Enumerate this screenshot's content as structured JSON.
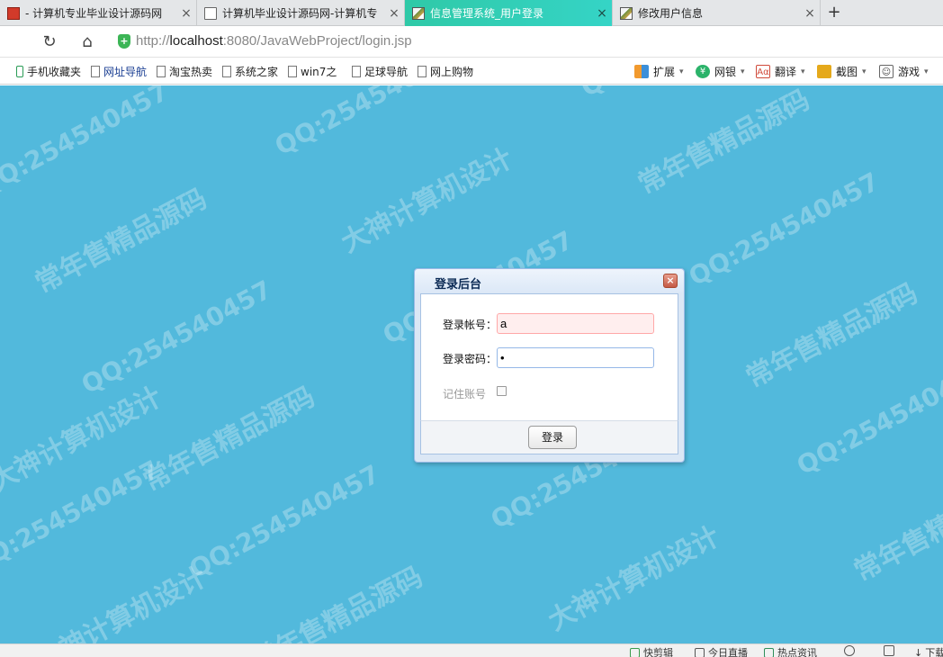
{
  "tabs": [
    {
      "title": "- 计算机专业毕业设计源码网",
      "favicon": "red-logo-icon",
      "active": false
    },
    {
      "title": "计算机毕业设计源码网-计算机专",
      "favicon": "page-icon",
      "active": false
    },
    {
      "title": "信息管理系统_用户登录",
      "favicon": "image-icon",
      "active": true
    },
    {
      "title": "修改用户信息",
      "favicon": "image-icon",
      "active": false
    }
  ],
  "tab_close_glyph": "×",
  "new_tab_glyph": "+",
  "nav": {
    "reload_glyph": "↻",
    "home_glyph": "⌂",
    "url_scheme": "http://",
    "url_host": "localhost",
    "url_rest": ":8080/JavaWebProject/login.jsp"
  },
  "bookmarks": [
    {
      "label": "手机收藏夹",
      "icon": "phone-icon"
    },
    {
      "label": "网址导航",
      "icon": "page-icon"
    },
    {
      "label": "淘宝热卖",
      "icon": "page-icon"
    },
    {
      "label": "系统之家",
      "icon": "page-icon"
    },
    {
      "label": "win7之",
      "icon": "page-icon"
    },
    {
      "label": "足球导航",
      "icon": "page-icon"
    },
    {
      "label": "网上购物",
      "icon": "page-icon"
    }
  ],
  "toolbar_right": [
    {
      "label": "扩展",
      "icon": "extension-icon"
    },
    {
      "label": "网银",
      "icon": "bank-icon"
    },
    {
      "label": "翻译",
      "icon": "translate-icon"
    },
    {
      "label": "截图",
      "icon": "screenshot-icon"
    },
    {
      "label": "游戏",
      "icon": "game-icon"
    }
  ],
  "dialog": {
    "title": "登录后台",
    "close_glyph": "×",
    "account_label": "登录帐号：",
    "account_value": "a",
    "password_label": "登录密码：",
    "password_value": "•",
    "remember_label": "记住账号",
    "remember_checked": false,
    "login_button": "登录"
  },
  "watermarks": {
    "qq": "QQ:254540457",
    "slogan": "常年售精品源码",
    "brand": "大神计算机设计"
  },
  "statusbar": [
    {
      "label": "快剪辑",
      "icon": "scissors-icon"
    },
    {
      "label": "今日直播",
      "icon": "tv-icon"
    },
    {
      "label": "热点资讯",
      "icon": "news-icon"
    },
    {
      "label": "下载",
      "icon": "download-icon"
    }
  ],
  "colors": {
    "page_background": "#52b9dc",
    "active_tab": "#2fc9a7",
    "invalid_field": "#ffeeee"
  }
}
